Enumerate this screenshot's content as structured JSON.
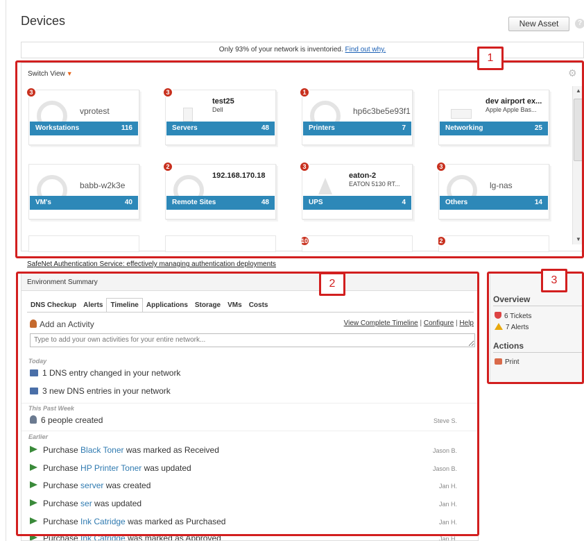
{
  "page": {
    "title": "Devices",
    "new_asset_label": "New Asset",
    "help_glyph": "?"
  },
  "banner": {
    "text": "Only 93% of your network is inventoried.",
    "link": "Find out why."
  },
  "devices": {
    "switch_view": "Switch View",
    "tiles": [
      {
        "badge": "3",
        "name": "vprotest",
        "sub": "",
        "category": "Workstations",
        "count": "116",
        "icon": "gauge-icon"
      },
      {
        "badge": "3",
        "name": "test25",
        "sub": "Dell",
        "category": "Servers",
        "count": "48",
        "icon": "server-icon"
      },
      {
        "badge": "1",
        "name": "hp6c3be5e93f1",
        "sub": "",
        "category": "Printers",
        "count": "7",
        "icon": "gauge-icon"
      },
      {
        "badge": "",
        "name": "dev airport ex...",
        "sub": "Apple Apple Bas...",
        "category": "Networking",
        "count": "25",
        "icon": "router-icon"
      },
      {
        "badge": "",
        "name": "babb-w2k3e",
        "sub": "",
        "category": "VM's",
        "count": "40",
        "icon": "gauge-icon"
      },
      {
        "badge": "2",
        "name": "192.168.170.18",
        "sub": "",
        "category": "Remote Sites",
        "count": "48",
        "icon": "gauge-icon"
      },
      {
        "badge": "3",
        "name": "eaton-2",
        "sub": "EATON 5130 RT...",
        "category": "UPS",
        "count": "4",
        "icon": "ups-icon"
      },
      {
        "badge": "3",
        "name": "lg-nas",
        "sub": "",
        "category": "Others",
        "count": "14",
        "icon": "gauge-icon"
      }
    ],
    "partial_badges": [
      "",
      "",
      "10",
      "2"
    ]
  },
  "sponsor_link": "SafeNet Authentication Service: effectively managing authentication deployments",
  "environment": {
    "header": "Environment Summary",
    "tabs": [
      "DNS Checkup",
      "Alerts",
      "Timeline",
      "Applications",
      "Storage",
      "VMs",
      "Costs"
    ],
    "active_tab": "Timeline",
    "add_activity": "Add an Activity",
    "links": {
      "view": "View Complete Timeline",
      "configure": "Configure",
      "help": "Help",
      "sep": "|"
    },
    "input_placeholder": "Type to add your own activities for your entire network...",
    "sections": {
      "today": "Today",
      "week": "This Past Week",
      "earlier": "Earlier"
    },
    "today_rows": [
      "1 DNS entry changed in your network",
      "3 new DNS entries in your network"
    ],
    "week_rows": [
      {
        "text": "6 people created",
        "who": "Steve S."
      }
    ],
    "earlier_rows": [
      {
        "pre": "Purchase ",
        "link": "Black Toner",
        "post": " was marked as Received",
        "who": "Jason B."
      },
      {
        "pre": "Purchase ",
        "link": "HP Printer Toner",
        "post": " was updated",
        "who": "Jason B."
      },
      {
        "pre": "Purchase ",
        "link": "server",
        "post": " was created",
        "who": "Jan H."
      },
      {
        "pre": "Purchase ",
        "link": "ser",
        "post": " was updated",
        "who": "Jan H."
      },
      {
        "pre": "Purchase ",
        "link": "Ink Catridge",
        "post": " was marked as Purchased",
        "who": "Jan H."
      },
      {
        "pre": "Purchase ",
        "link": "Ink Catridge",
        "post": " was marked as Approved",
        "who": "Jan H."
      }
    ]
  },
  "sidebar": {
    "overview": "Overview",
    "tickets": "6 Tickets",
    "alerts": "7 Alerts",
    "actions": "Actions",
    "print": "Print"
  },
  "annotations": [
    "1",
    "2",
    "3"
  ],
  "colors": {
    "tile_bar": "#2d88b8",
    "badge": "#c8311f",
    "annotation": "#d21f1f",
    "link": "#2f7ab0"
  }
}
